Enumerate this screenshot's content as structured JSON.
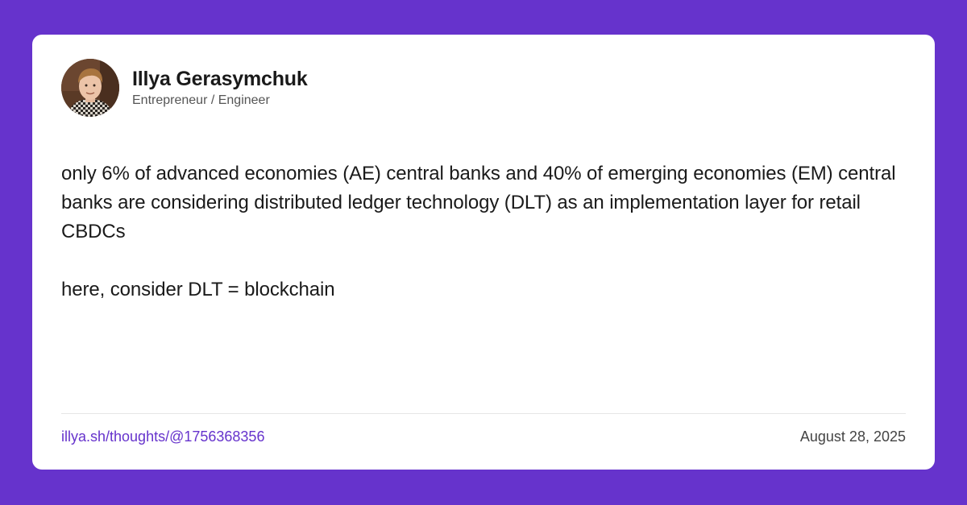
{
  "author": {
    "name": "Illya Gerasymchuk",
    "role": "Entrepreneur / Engineer"
  },
  "post": {
    "paragraphs": [
      "only 6% of advanced economies (AE) central banks and 40% of emerging economies (EM) central banks are considering distributed ledger technology (DLT) as an implementation layer for retail CBDCs",
      "here, consider DLT = blockchain"
    ]
  },
  "footer": {
    "link": "illya.sh/thoughts/@1756368356",
    "date": "August 28, 2025"
  },
  "colors": {
    "background": "#6633cc",
    "card": "#ffffff",
    "link": "#6633cc",
    "text": "#1a1a1a"
  }
}
